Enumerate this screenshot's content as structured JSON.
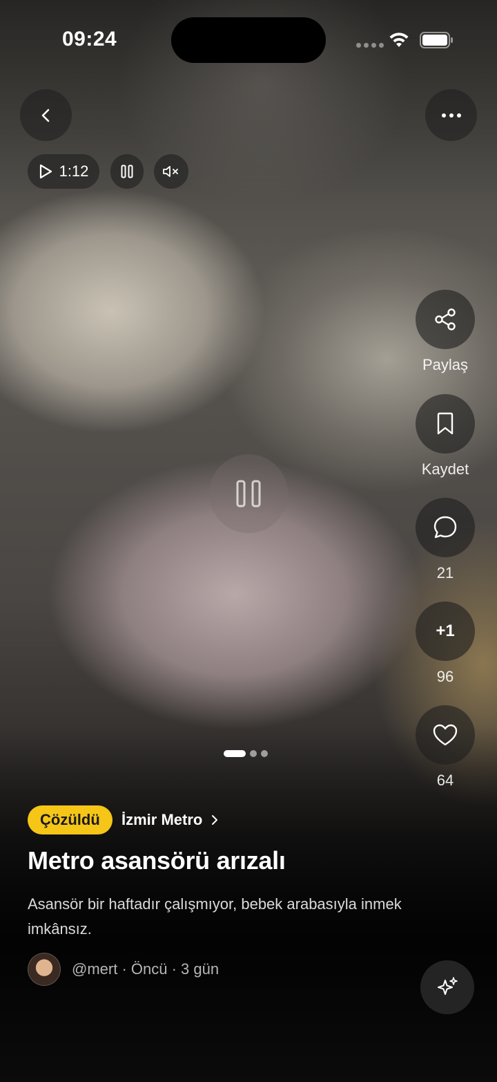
{
  "status_bar": {
    "time": "09:24"
  },
  "player": {
    "duration": "1:12"
  },
  "actions": {
    "share_label": "Paylaş",
    "save_label": "Kaydet",
    "comments_count": "21",
    "plus_one_label": "+1",
    "plus_one_count": "96",
    "likes_count": "64"
  },
  "carousel": {
    "total": 3,
    "active_index": 0
  },
  "post": {
    "status_badge": "Çözüldü",
    "agency": "İzmir Metro",
    "title": "Metro asansörü arızalı",
    "description": "Asansör bir haftadır çalışmıyor, bebek arabasıyla inmek imkânsız.",
    "author_line": "@mert · Öncü · 3 gün"
  },
  "colors": {
    "badge": "#f5c518",
    "badge_text": "#1a1a1a"
  },
  "icons": [
    "back-icon",
    "more-icon",
    "play-icon",
    "pause-icon",
    "mute-icon",
    "share-icon",
    "bookmark-icon",
    "comment-icon",
    "heart-icon",
    "sparkle-icon"
  ]
}
